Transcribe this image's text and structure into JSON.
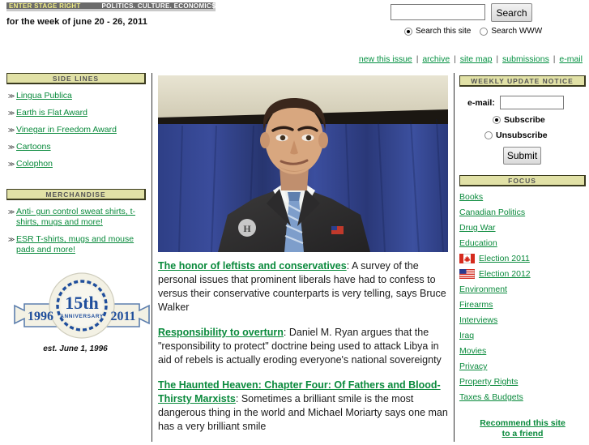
{
  "header": {
    "banner_title": "ENTER STAGE RIGHT",
    "banner_tagline": "POLITICS. CULTURE. ECONOMICS.",
    "dateline": "for the week of june 20 - 26, 2011"
  },
  "search": {
    "value": "",
    "button_label": "Search",
    "scope_site_label": "Search this site",
    "scope_web_label": "Search WWW",
    "selected_scope": "Search this site"
  },
  "topnav": {
    "items": [
      {
        "label": "new this issue"
      },
      {
        "label": "archive"
      },
      {
        "label": "site map"
      },
      {
        "label": "submissions"
      },
      {
        "label": "e-mail"
      }
    ],
    "separator": "|"
  },
  "sidelines": {
    "heading": "SIDE LINES",
    "bullet": "≫",
    "items": [
      {
        "label": "Lingua Publica"
      },
      {
        "label": "Earth is Flat Award"
      },
      {
        "label": "Vinegar in Freedom Award"
      },
      {
        "label": "Cartoons"
      },
      {
        "label": "Colophon"
      }
    ]
  },
  "merchandise": {
    "heading": "MERCHANDISE",
    "items": [
      {
        "label": "Anti- gun control sweat shirts, t-shirts, mugs and more!"
      },
      {
        "label": "ESR T-shirts, mugs and mouse pads and more!"
      }
    ]
  },
  "anniversary": {
    "year_left": "1996",
    "year_right": "2011",
    "big_text": "15th",
    "small_text": "ANNIVERSARY",
    "established": "est. June 1, 1996"
  },
  "articles": [
    {
      "title": "The honor of leftists and conservatives",
      "summary": ": A survey of the personal issues that prominent liberals have had to confess to versus their conservative counterparts is very telling, says Bruce Walker"
    },
    {
      "title": "Responsibility to overturn",
      "summary": ": Daniel M. Ryan argues that the \"responsibility to protect\" doctrine being used to attack Libya in aid of rebels is actually eroding everyone's national sovereignty"
    },
    {
      "title": "The Haunted Heaven: Chapter Four: Of Fathers and Blood-Thirsty Marxists",
      "summary": ": Sometimes a brilliant smile is the most dangerous thing in the world and Michael Moriarty says one man has a very brilliant smile"
    }
  ],
  "weekly_update": {
    "heading": "WEEKLY UPDATE NOTICE",
    "email_label": "e-mail:",
    "email_value": "",
    "subscribe_label": "Subscribe",
    "unsubscribe_label": "Unsubscribe",
    "selected_option": "Subscribe",
    "submit_label": "Submit"
  },
  "focus": {
    "heading": "FOCUS",
    "items": [
      {
        "label": "Books",
        "flag": ""
      },
      {
        "label": "Canadian Politics",
        "flag": ""
      },
      {
        "label": "Drug War",
        "flag": ""
      },
      {
        "label": "Education",
        "flag": ""
      },
      {
        "label": "Election 2011",
        "flag": "canada-flag-icon"
      },
      {
        "label": "Election 2012",
        "flag": "usa-flag-icon"
      },
      {
        "label": "Environment",
        "flag": ""
      },
      {
        "label": "Firearms",
        "flag": ""
      },
      {
        "label": "Interviews",
        "flag": ""
      },
      {
        "label": "Iraq",
        "flag": ""
      },
      {
        "label": "Movies",
        "flag": ""
      },
      {
        "label": "Privacy",
        "flag": ""
      },
      {
        "label": "Property Rights",
        "flag": ""
      },
      {
        "label": "Taxes & Budgets",
        "flag": ""
      }
    ]
  },
  "recommend": {
    "line1": "Recommend this site",
    "line2": "to a friend"
  },
  "colors": {
    "link_green": "#0a8a3c",
    "section_bar": "#e1e1a6",
    "banner_gray": "#6b6b6b",
    "banner_yellow": "#f2ef86"
  }
}
